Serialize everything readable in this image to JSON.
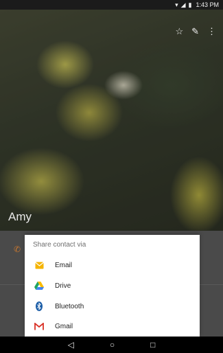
{
  "status_bar": {
    "icons": [
      "wifi-icon",
      "signal-icon",
      "battery-icon"
    ],
    "time": "1:43 PM"
  },
  "contact": {
    "name": "Amy",
    "actions": [
      "star-icon",
      "edit-icon",
      "more-icon"
    ]
  },
  "share_sheet": {
    "title": "Share contact via",
    "options": [
      {
        "label": "Email",
        "icon": "email-icon",
        "color": "#f5b400"
      },
      {
        "label": "Drive",
        "icon": "drive-icon",
        "color": "#1fa463"
      },
      {
        "label": "Bluetooth",
        "icon": "bluetooth-icon",
        "color": "#1e5fa8"
      },
      {
        "label": "Gmail",
        "icon": "gmail-icon",
        "color": "#d93025"
      }
    ]
  },
  "nav_bar": {
    "buttons": [
      "back-icon",
      "home-icon",
      "recents-icon"
    ]
  },
  "colors": {
    "phone_accent": "#c9772f"
  }
}
